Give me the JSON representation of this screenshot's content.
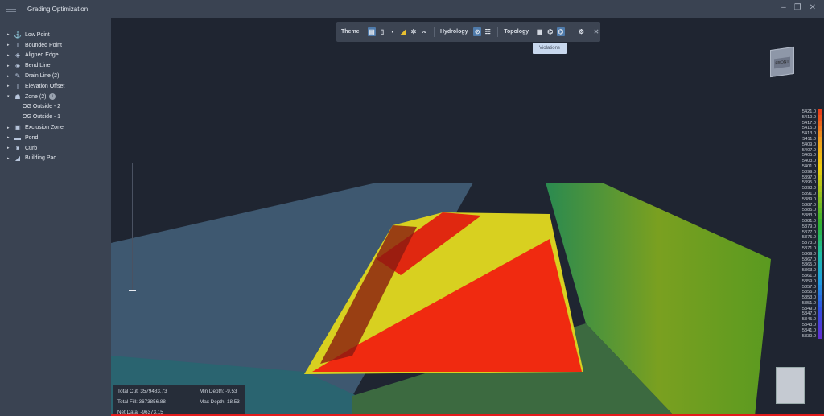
{
  "app": {
    "title": "Grading Optimization"
  },
  "window": {
    "minimize": "–",
    "restore": "❐",
    "close": "✕"
  },
  "sidebar": {
    "items": [
      {
        "label": "Low Point",
        "icon": "anchor-icon",
        "glyph": "⚓",
        "expand": "▸"
      },
      {
        "label": "Bounded Point",
        "icon": "bounded-point-icon",
        "glyph": "Ι",
        "expand": "▸"
      },
      {
        "label": "Aligned Edge",
        "icon": "aligned-edge-icon",
        "glyph": "◈",
        "expand": "▸"
      },
      {
        "label": "Bend Line",
        "icon": "bend-line-icon",
        "glyph": "◈",
        "expand": "▸"
      },
      {
        "label": "Drain Line (2)",
        "icon": "drain-line-icon",
        "glyph": "✎",
        "expand": "▸"
      },
      {
        "label": "Elevation Offset",
        "icon": "elevation-offset-icon",
        "glyph": "Ι",
        "expand": "▸"
      },
      {
        "label": "Zone (2)",
        "icon": "zone-icon",
        "glyph": "☗",
        "expand": "▾",
        "info": "i"
      },
      {
        "label": "OG Outside - 2",
        "sub": true
      },
      {
        "label": "OG Outside - 1",
        "sub": true
      },
      {
        "label": "Exclusion Zone",
        "icon": "exclusion-zone-icon",
        "glyph": "▣",
        "expand": "▸"
      },
      {
        "label": "Pond",
        "icon": "pond-icon",
        "glyph": "▬",
        "expand": "▸"
      },
      {
        "label": "Curb",
        "icon": "curb-icon",
        "glyph": "♜",
        "expand": "▸"
      },
      {
        "label": "Building Pad",
        "icon": "building-pad-icon",
        "glyph": "◢",
        "expand": "▸"
      }
    ]
  },
  "toolbar": {
    "theme": "Theme",
    "hydrology": "Hydrology",
    "topology": "Topology",
    "tooltip": "Violations"
  },
  "legend": {
    "values": [
      "5421.0",
      "5419.0",
      "5417.0",
      "5415.0",
      "5413.0",
      "5411.0",
      "5409.0",
      "5407.0",
      "5405.0",
      "5403.0",
      "5401.0",
      "5399.0",
      "5397.0",
      "5395.0",
      "5393.0",
      "5391.0",
      "5389.0",
      "5387.0",
      "5385.0",
      "5383.0",
      "5381.0",
      "5379.0",
      "5377.0",
      "5375.0",
      "5373.0",
      "5371.0",
      "5369.0",
      "5367.0",
      "5365.0",
      "5363.0",
      "5361.0",
      "5359.0",
      "5357.0",
      "5355.0",
      "5353.0",
      "5351.0",
      "5349.0",
      "5347.0",
      "5345.0",
      "5343.0",
      "5341.0",
      "5339.0"
    ],
    "colors_top_to_bottom": [
      "#e8401a",
      "#f0a020",
      "#f0d010",
      "#90c020",
      "#30b030",
      "#20c0a0",
      "#20a0e0",
      "#3050e0",
      "#6030d0"
    ]
  },
  "viewcube": {
    "label": "FRONT"
  },
  "stats": {
    "total_cut": "Total Cut: 3579483.73",
    "total_fill": "Total Fill: 3673856.88",
    "net_data": "Net Data: -96373.15",
    "min_depth": "Min Depth: -9.53",
    "max_depth": "Max Depth: 18.53"
  }
}
